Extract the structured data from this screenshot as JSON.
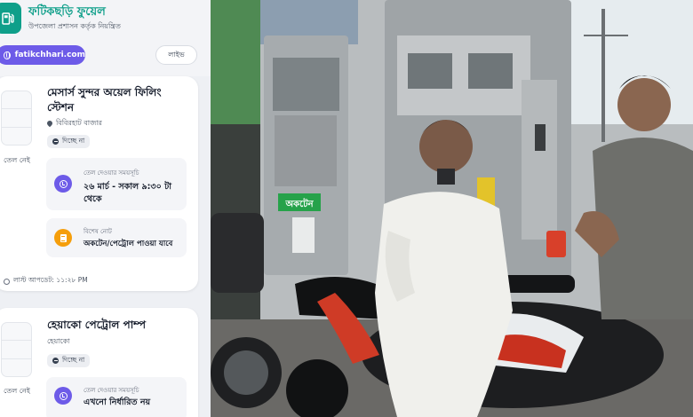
{
  "header": {
    "app_title": "ফটিকছড়ি ফুয়েল",
    "app_subtitle": "উপজেলা প্রশাসন কর্তৃক নিয়ন্ত্রিত",
    "site_link": "fatikchhari.com",
    "live_label": "লাইভ"
  },
  "stations": [
    {
      "name": "মেসার্স সুন্দর অয়েল ফিলিং স্টেশন",
      "location": "বিবিরহাট বাজার",
      "status": "দিচ্ছে না",
      "fuel_label": "তেল নেই",
      "time_label": "তেল দেওয়ার সময়সূচি",
      "time_value": "২৬ মার্চ - সকাল ৯:৩০ টা থেকে",
      "note_label": "বিশেষ নোট",
      "note_value": "অকটেন/পেট্রোল পাওয়া যাবে",
      "last_updated": "লাস্ট আপডেট: ১১:২৮ PM"
    },
    {
      "name": "হেয়াকো পেট্রোল পাম্প",
      "location": "হেয়াকো",
      "status": "দিচ্ছে না",
      "fuel_label": "তেল নেই",
      "time_label": "তেল দেওয়ার সময়সূচি",
      "time_value": "এখনো নির্ধারিত নয়"
    }
  ],
  "photo": {
    "pump_sign": "অকটেন"
  },
  "colors": {
    "brand": "#0f9f8a",
    "accent": "#6d5be8",
    "note_icon": "#f59e0b"
  },
  "icons": [
    "fuel-pump-icon",
    "globe-icon",
    "location-pin-icon",
    "status-dot-icon",
    "clock-icon",
    "note-icon",
    "time-icon"
  ]
}
